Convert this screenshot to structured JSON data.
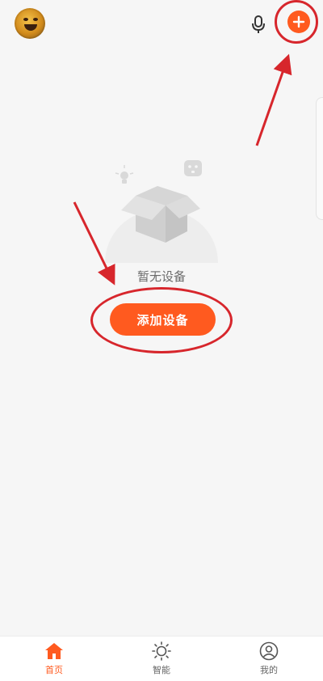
{
  "header": {
    "avatar_icon": "user-avatar",
    "mic_icon": "microphone-icon",
    "add_icon": "plus-icon"
  },
  "empty_state": {
    "illustration_icon": "empty-box-icon",
    "message": "暂无设备",
    "add_button_label": "添加设备"
  },
  "bottom_nav": {
    "items": [
      {
        "label": "首页",
        "icon": "home-icon",
        "active": true
      },
      {
        "label": "智能",
        "icon": "sun-icon",
        "active": false
      },
      {
        "label": "我的",
        "icon": "user-icon",
        "active": false
      }
    ]
  },
  "colors": {
    "accent": "#ff5a1f",
    "annotation": "#d7262c",
    "background": "#f6f6f6",
    "nav_inactive": "#666666"
  }
}
